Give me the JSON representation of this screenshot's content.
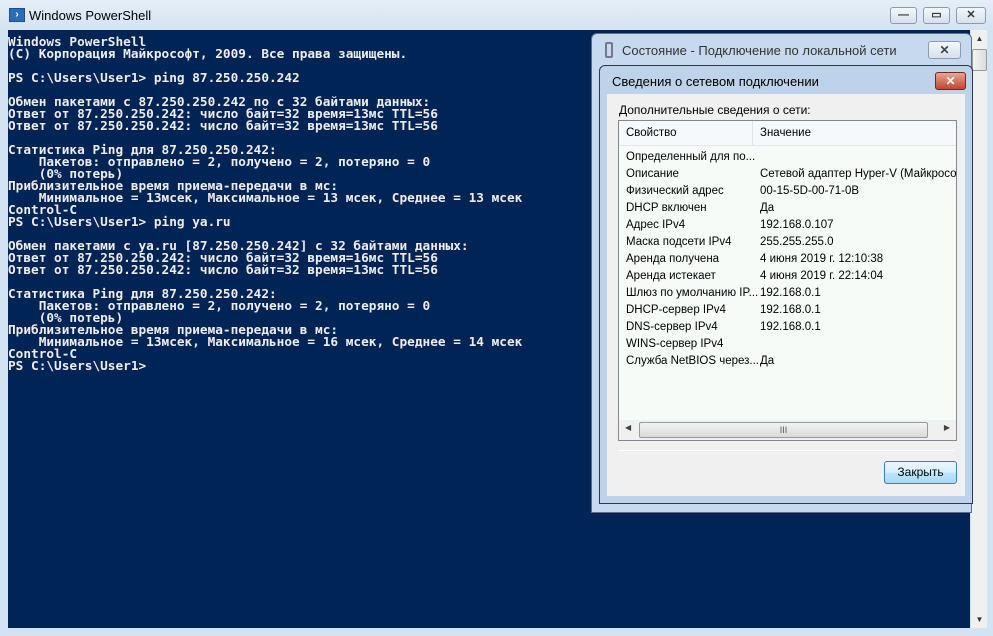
{
  "powershell": {
    "title": "Windows PowerShell",
    "controls": {
      "minimize": "—",
      "maximize": "▭",
      "close": "✕"
    },
    "console_lines": [
      "Windows PowerShell",
      "(C) Корпорация Майкрософт, 2009. Все права защищены.",
      "",
      "PS C:\\Users\\User1> ping 87.250.250.242",
      "",
      "Обмен пакетами с 87.250.250.242 по с 32 байтами данных:",
      "Ответ от 87.250.250.242: число байт=32 время=13мс TTL=56",
      "Ответ от 87.250.250.242: число байт=32 время=13мс TTL=56",
      "",
      "Статистика Ping для 87.250.250.242:",
      "    Пакетов: отправлено = 2, получено = 2, потеряно = 0",
      "    (0% потерь)",
      "Приблизительное время приема-передачи в мс:",
      "    Минимальное = 13мсек, Максимальное = 13 мсек, Среднее = 13 мсек",
      "Control-C",
      "PS C:\\Users\\User1> ping ya.ru",
      "",
      "Обмен пакетами с ya.ru [87.250.250.242] с 32 байтами данных:",
      "Ответ от 87.250.250.242: число байт=32 время=16мс TTL=56",
      "Ответ от 87.250.250.242: число байт=32 время=13мс TTL=56",
      "",
      "Статистика Ping для 87.250.250.242:",
      "    Пакетов: отправлено = 2, получено = 2, потеряно = 0",
      "    (0% потерь)",
      "Приблизительное время приема-передачи в мс:",
      "    Минимальное = 13мсек, Максимальное = 16 мсек, Среднее = 14 мсек",
      "Control-C",
      "PS C:\\Users\\User1>"
    ]
  },
  "status_dialog": {
    "title": "Состояние - Подключение по локальной сети",
    "close": "✕"
  },
  "details_dialog": {
    "title": "Сведения о сетевом подключении",
    "close": "✕",
    "label": "Дополнительные сведения о сети:",
    "columns": [
      "Свойство",
      "Значение"
    ],
    "rows": [
      [
        "Определенный для по...",
        ""
      ],
      [
        "Описание",
        "Сетевой адаптер Hyper-V (Майкрософт)"
      ],
      [
        "Физический адрес",
        "00-15-5D-00-71-0B"
      ],
      [
        "DHCP включен",
        "Да"
      ],
      [
        "Адрес IPv4",
        "192.168.0.107"
      ],
      [
        "Маска подсети IPv4",
        "255.255.255.0"
      ],
      [
        "Аренда получена",
        "4 июня 2019 г. 12:10:38"
      ],
      [
        "Аренда истекает",
        "4 июня 2019 г. 22:14:04"
      ],
      [
        "Шлюз по умолчанию IP...",
        "192.168.0.1"
      ],
      [
        "DHCP-сервер IPv4",
        "192.168.0.1"
      ],
      [
        "DNS-сервер IPv4",
        "192.168.0.1"
      ],
      [
        "WINS-сервер IPv4",
        ""
      ],
      [
        "Служба NetBIOS через...",
        "Да"
      ]
    ],
    "scroll_grip": "III",
    "close_button": "Закрыть"
  }
}
